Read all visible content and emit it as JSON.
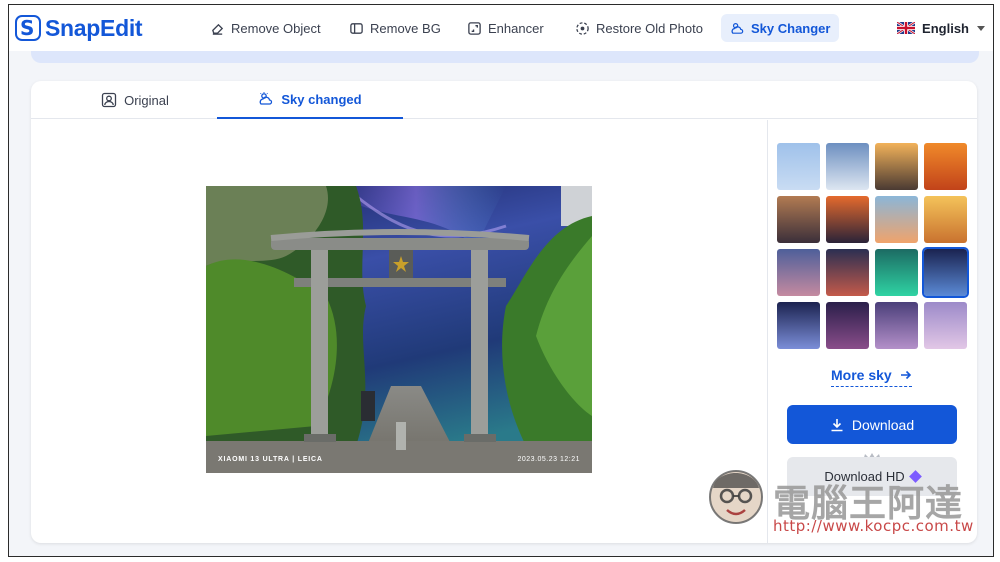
{
  "app": {
    "logo_text": "SnapEdit",
    "logo_letter": "S"
  },
  "nav": {
    "items": [
      {
        "label": "Remove Object",
        "icon": "eraser-icon"
      },
      {
        "label": "Remove BG",
        "icon": "remove-bg-icon"
      },
      {
        "label": "Enhancer",
        "icon": "enhancer-icon"
      },
      {
        "label": "Restore Old Photo",
        "icon": "restore-icon"
      },
      {
        "label": "Sky Changer",
        "icon": "sky-icon",
        "active": true
      }
    ],
    "language": "English"
  },
  "tabs": [
    {
      "label": "Original",
      "icon": "person-icon"
    },
    {
      "label": "Sky changed",
      "icon": "sky-icon",
      "active": true
    }
  ],
  "photo": {
    "watermark_left": "XIAOMI 13 ULTRA | LEICA",
    "watermark_right": "2023.05.23  12:21"
  },
  "sky_presets": [
    {
      "colors": [
        "#9fc1ea",
        "#c9dcf3"
      ]
    },
    {
      "colors": [
        "#6d8fc0",
        "#dde6f1"
      ]
    },
    {
      "colors": [
        "#f2b25a",
        "#4a3a33"
      ]
    },
    {
      "colors": [
        "#f08a2a",
        "#c2431a"
      ]
    },
    {
      "colors": [
        "#b27b52",
        "#3b2f3a"
      ]
    },
    {
      "colors": [
        "#e56a2d",
        "#2a2338"
      ]
    },
    {
      "colors": [
        "#8bb6d8",
        "#f0a36b"
      ]
    },
    {
      "colors": [
        "#f4c35a",
        "#c9722f"
      ]
    },
    {
      "colors": [
        "#4e5f9a",
        "#c58aa0"
      ]
    },
    {
      "colors": [
        "#2b2f52",
        "#c45a4a"
      ]
    },
    {
      "colors": [
        "#1c6b63",
        "#2fd3a3"
      ]
    },
    {
      "colors": [
        "#1a2350",
        "#5b8ad6"
      ],
      "selected": true
    },
    {
      "colors": [
        "#1c2350",
        "#7b8ed8"
      ]
    },
    {
      "colors": [
        "#2a1f4a",
        "#8a4d8a"
      ]
    },
    {
      "colors": [
        "#4b3f7a",
        "#b490c9"
      ]
    },
    {
      "colors": [
        "#9c8ac9",
        "#e2c7e6"
      ]
    }
  ],
  "sidebar": {
    "more_sky": "More sky",
    "download": "Download",
    "download_hd": "Download HD"
  },
  "site_watermark": {
    "title": "電腦王阿達",
    "url": "http://www.kocpc.com.tw"
  },
  "colors": {
    "accent": "#1357d8",
    "nav_active_bg": "#e8effc"
  }
}
